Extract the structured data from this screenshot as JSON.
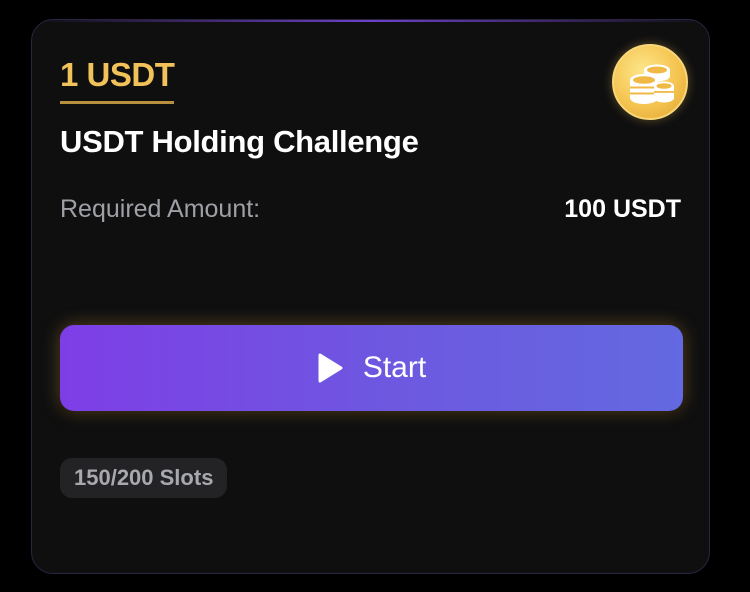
{
  "card": {
    "reward": "1 USDT",
    "title": "USDT Holding Challenge",
    "required_label": "Required Amount:",
    "required_value": "100 USDT",
    "coin_icon": "coins-stack-icon",
    "start_button": {
      "label": "Start",
      "icon": "play-icon"
    },
    "slots": "150/200 Slots"
  },
  "colors": {
    "background": "#000000",
    "card_bg": "#0f0f10",
    "reward_gold": "#f1c15a",
    "button_gradient_start": "#7e3ee6",
    "button_gradient_end": "#6369e0",
    "muted_text": "#9ea0a6"
  }
}
